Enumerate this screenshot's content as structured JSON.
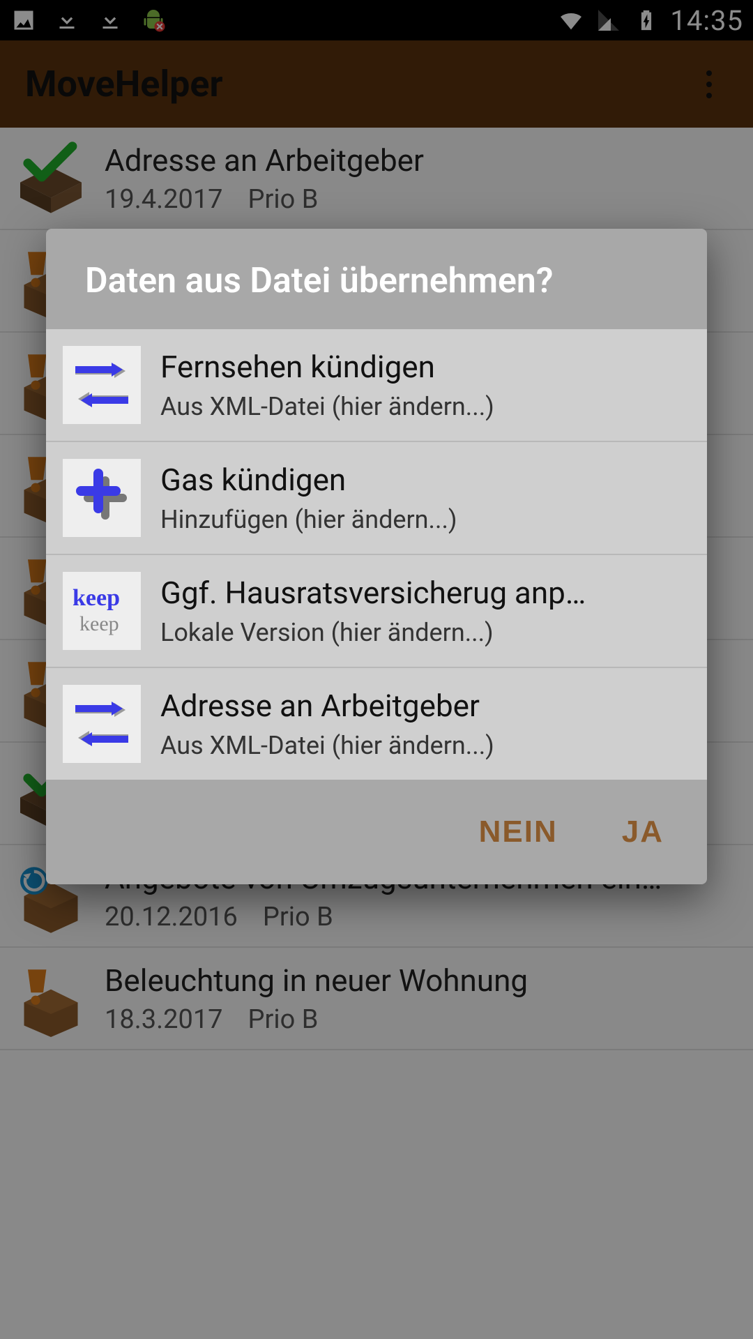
{
  "status": {
    "time": "14:35"
  },
  "app": {
    "title": "MoveHelper"
  },
  "list": [
    {
      "icon": "done",
      "title": "Adresse an Arbeitgeber",
      "date": "19.4.2017",
      "prio": "Prio B"
    },
    {
      "icon": "warn",
      "title": "",
      "date": "",
      "prio": ""
    },
    {
      "icon": "warn",
      "title": "",
      "date": "",
      "prio": ""
    },
    {
      "icon": "warn",
      "title": "",
      "date": "",
      "prio": ""
    },
    {
      "icon": "warn",
      "title": "",
      "date": "",
      "prio": ""
    },
    {
      "icon": "warn",
      "title": "",
      "date": "",
      "prio": ""
    },
    {
      "icon": "done",
      "title": "",
      "date": "",
      "prio": ""
    },
    {
      "icon": "refresh",
      "title": "Angebote von Umzugsunternehmen ein…",
      "date": "20.12.2016",
      "prio": "Prio B"
    },
    {
      "icon": "warn",
      "title": "Beleuchtung in neuer Wohnung",
      "date": "18.3.2017",
      "prio": "Prio B"
    }
  ],
  "dialog": {
    "title": "Daten aus Datei übernehmen?",
    "items": [
      {
        "icon": "swap",
        "title": "Fernsehen kündigen",
        "sub": "Aus XML-Datei (hier ändern...)"
      },
      {
        "icon": "plus",
        "title": "Gas kündigen",
        "sub": "Hinzufügen (hier ändern...)"
      },
      {
        "icon": "keep",
        "title": "Ggf. Hausratsversicherug anp…",
        "sub": "Lokale Version (hier ändern...)"
      },
      {
        "icon": "swap",
        "title": "Adresse an Arbeitgeber",
        "sub": "Aus XML-Datei (hier ändern...)"
      }
    ],
    "no": "NEIN",
    "yes": "JA"
  }
}
